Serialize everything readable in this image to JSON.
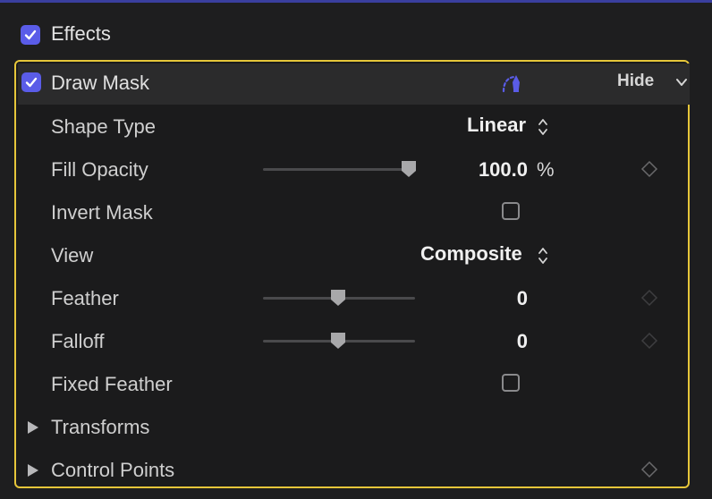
{
  "effects": {
    "label": "Effects",
    "checked": true
  },
  "draw_mask": {
    "label": "Draw Mask",
    "checked": true,
    "hide_label": "Hide",
    "accent_color": "#5a5ce8",
    "highlight_color": "#e6c63a"
  },
  "params": {
    "shape_type": {
      "label": "Shape Type",
      "value": "Linear"
    },
    "fill_opacity": {
      "label": "Fill Opacity",
      "value": "100.0",
      "unit": "%",
      "slider_level": 0.96
    },
    "invert_mask": {
      "label": "Invert Mask",
      "checked": false
    },
    "view": {
      "label": "View",
      "value": "Composite"
    },
    "feather": {
      "label": "Feather",
      "value": "0",
      "slider_level": 0.5
    },
    "falloff": {
      "label": "Falloff",
      "value": "0",
      "slider_level": 0.5
    },
    "fixed_feather": {
      "label": "Fixed Feather",
      "checked": false
    },
    "transforms": {
      "label": "Transforms",
      "expanded": false
    },
    "control_points": {
      "label": "Control Points",
      "expanded": false
    }
  },
  "icons": {
    "checkmark": "checkmark-icon",
    "mask_tool": "draw-mask-pen-icon",
    "stepper": "up-down-stepper-icon",
    "keyframe": "keyframe-diamond-icon",
    "disclosure": "disclosure-triangle-icon",
    "chevron": "chevron-down-icon"
  }
}
